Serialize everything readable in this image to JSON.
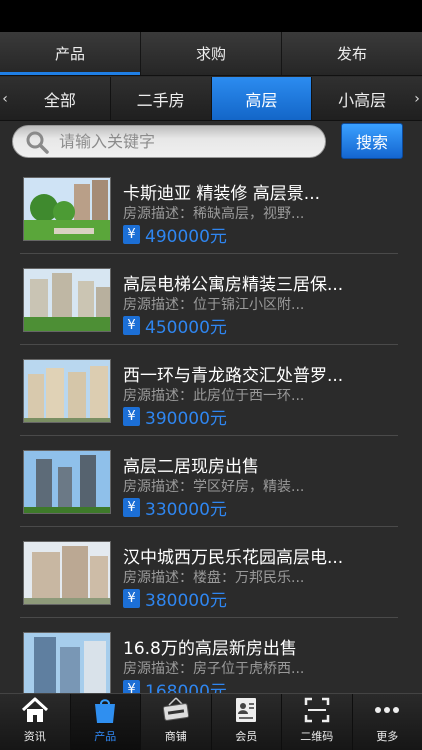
{
  "top_tabs": [
    {
      "label": "产品",
      "active": true
    },
    {
      "label": "求购",
      "active": false
    },
    {
      "label": "发布",
      "active": false
    }
  ],
  "categories": {
    "left_arrow": "‹",
    "right_arrow": "›",
    "items": [
      {
        "label": "全部",
        "active": false
      },
      {
        "label": "二手房",
        "active": false
      },
      {
        "label": "高层",
        "active": true
      },
      {
        "label": "小高层",
        "active": false
      }
    ]
  },
  "search": {
    "placeholder": "请输入关键字",
    "button_label": "搜索"
  },
  "listings": [
    {
      "title": "卡斯迪亚 精装修 高层景...",
      "desc": "房源描述：稀缺高层，视野...",
      "currency": "¥",
      "price": "490000元"
    },
    {
      "title": "高层电梯公寓房精装三居保...",
      "desc": "房源描述：位于锦江小区附...",
      "currency": "¥",
      "price": "450000元"
    },
    {
      "title": "西一环与青龙路交汇处普罗...",
      "desc": "房源描述：此房位于西一环...",
      "currency": "¥",
      "price": "390000元"
    },
    {
      "title": "高层二居现房出售",
      "desc": "房源描述：学区好房，精装...",
      "currency": "¥",
      "price": "330000元"
    },
    {
      "title": "汉中城西万民乐花园高层电...",
      "desc": "房源描述：楼盘：万邦民乐...",
      "currency": "¥",
      "price": "380000元"
    },
    {
      "title": "16.8万的高层新房出售",
      "desc": "房源描述：房子位于虎桥西...",
      "currency": "¥",
      "price": "168000元"
    }
  ],
  "bottom_nav": [
    {
      "label": "资讯",
      "icon": "home-icon",
      "active": false
    },
    {
      "label": "产品",
      "icon": "shopping-bag-icon",
      "active": true
    },
    {
      "label": "商铺",
      "icon": "open-sign-icon",
      "active": false
    },
    {
      "label": "会员",
      "icon": "member-card-icon",
      "active": false
    },
    {
      "label": "二维码",
      "icon": "qr-scan-icon",
      "active": false
    },
    {
      "label": "更多",
      "icon": "more-dots-icon",
      "active": false
    }
  ],
  "colors": {
    "accent": "#1f7fe6",
    "price": "#2f86f0",
    "background": "#2b2b2b"
  }
}
